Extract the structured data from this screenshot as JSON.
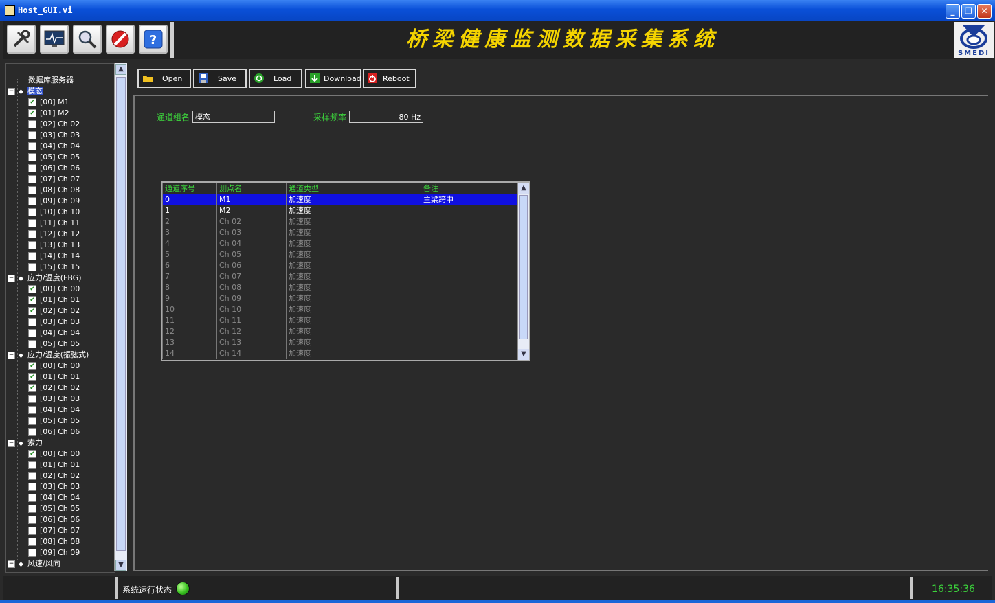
{
  "window": {
    "title": "Host_GUI.vi",
    "controls": [
      "_",
      "❐",
      "✕"
    ]
  },
  "header": {
    "app_title": "桥梁健康监测数据采集系统",
    "logo_text": "SMEDI"
  },
  "toolbar_icons": [
    "tools-icon",
    "monitor-icon",
    "search-icon",
    "stop-icon",
    "help-icon"
  ],
  "tree": {
    "root": "数据库服务器",
    "groups": [
      {
        "name": "模态",
        "selected": true,
        "items": [
          {
            "label": "[00] M1",
            "checked": true
          },
          {
            "label": "[01] M2",
            "checked": true
          },
          {
            "label": "[02] Ch 02",
            "checked": false
          },
          {
            "label": "[03] Ch 03",
            "checked": false
          },
          {
            "label": "[04] Ch 04",
            "checked": false
          },
          {
            "label": "[05] Ch 05",
            "checked": false
          },
          {
            "label": "[06] Ch 06",
            "checked": false
          },
          {
            "label": "[07] Ch 07",
            "checked": false
          },
          {
            "label": "[08] Ch 08",
            "checked": false
          },
          {
            "label": "[09] Ch 09",
            "checked": false
          },
          {
            "label": "[10] Ch 10",
            "checked": false
          },
          {
            "label": "[11] Ch 11",
            "checked": false
          },
          {
            "label": "[12] Ch 12",
            "checked": false
          },
          {
            "label": "[13] Ch 13",
            "checked": false
          },
          {
            "label": "[14] Ch 14",
            "checked": false
          },
          {
            "label": "[15] Ch 15",
            "checked": false
          }
        ]
      },
      {
        "name": "应力/温度(FBG)",
        "selected": false,
        "items": [
          {
            "label": "[00] Ch 00",
            "checked": true
          },
          {
            "label": "[01] Ch 01",
            "checked": true
          },
          {
            "label": "[02] Ch 02",
            "checked": true
          },
          {
            "label": "[03] Ch 03",
            "checked": false
          },
          {
            "label": "[04] Ch 04",
            "checked": false
          },
          {
            "label": "[05] Ch 05",
            "checked": false
          }
        ]
      },
      {
        "name": "应力/温度(振弦式)",
        "selected": false,
        "items": [
          {
            "label": "[00] Ch 00",
            "checked": true
          },
          {
            "label": "[01] Ch 01",
            "checked": true
          },
          {
            "label": "[02] Ch 02",
            "checked": true
          },
          {
            "label": "[03] Ch 03",
            "checked": false
          },
          {
            "label": "[04] Ch 04",
            "checked": false
          },
          {
            "label": "[05] Ch 05",
            "checked": false
          },
          {
            "label": "[06] Ch 06",
            "checked": false
          }
        ]
      },
      {
        "name": "索力",
        "selected": false,
        "items": [
          {
            "label": "[00] Ch 00",
            "checked": true
          },
          {
            "label": "[01] Ch 01",
            "checked": false
          },
          {
            "label": "[02] Ch 02",
            "checked": false
          },
          {
            "label": "[03] Ch 03",
            "checked": false
          },
          {
            "label": "[04] Ch 04",
            "checked": false
          },
          {
            "label": "[05] Ch 05",
            "checked": false
          },
          {
            "label": "[06] Ch 06",
            "checked": false
          },
          {
            "label": "[07] Ch 07",
            "checked": false
          },
          {
            "label": "[08] Ch 08",
            "checked": false
          },
          {
            "label": "[09] Ch 09",
            "checked": false
          }
        ]
      },
      {
        "name": "风速/风向",
        "selected": false,
        "items": []
      }
    ]
  },
  "actions": {
    "open": "Open",
    "save": "Save",
    "load": "Load",
    "download": "Download",
    "reboot": "Reboot"
  },
  "form": {
    "group_name_label": "通道组名",
    "group_name_value": "模态",
    "sample_rate_label": "采样频率",
    "sample_rate_value": "80 Hz"
  },
  "table": {
    "headers": [
      "通道序号",
      "测点名",
      "通道类型",
      "备注"
    ],
    "rows": [
      {
        "cells": [
          "0",
          "M1",
          "加速度",
          "主梁跨中"
        ],
        "state": "selected"
      },
      {
        "cells": [
          "1",
          "M2",
          "加速度",
          ""
        ],
        "state": "active"
      },
      {
        "cells": [
          "2",
          "Ch 02",
          "加速度",
          ""
        ],
        "state": "inactive"
      },
      {
        "cells": [
          "3",
          "Ch 03",
          "加速度",
          ""
        ],
        "state": "inactive"
      },
      {
        "cells": [
          "4",
          "Ch 04",
          "加速度",
          ""
        ],
        "state": "inactive"
      },
      {
        "cells": [
          "5",
          "Ch 05",
          "加速度",
          ""
        ],
        "state": "inactive"
      },
      {
        "cells": [
          "6",
          "Ch 06",
          "加速度",
          ""
        ],
        "state": "inactive"
      },
      {
        "cells": [
          "7",
          "Ch 07",
          "加速度",
          ""
        ],
        "state": "inactive"
      },
      {
        "cells": [
          "8",
          "Ch 08",
          "加速度",
          ""
        ],
        "state": "inactive"
      },
      {
        "cells": [
          "9",
          "Ch 09",
          "加速度",
          ""
        ],
        "state": "inactive"
      },
      {
        "cells": [
          "10",
          "Ch 10",
          "加速度",
          ""
        ],
        "state": "inactive"
      },
      {
        "cells": [
          "11",
          "Ch 11",
          "加速度",
          ""
        ],
        "state": "inactive"
      },
      {
        "cells": [
          "12",
          "Ch 12",
          "加速度",
          ""
        ],
        "state": "inactive"
      },
      {
        "cells": [
          "13",
          "Ch 13",
          "加速度",
          ""
        ],
        "state": "inactive"
      },
      {
        "cells": [
          "14",
          "Ch 14",
          "加速度",
          ""
        ],
        "state": "inactive"
      }
    ]
  },
  "status": {
    "run_label": "系统运行状态",
    "clock": "16:35:36",
    "led_color": "#38c020"
  }
}
